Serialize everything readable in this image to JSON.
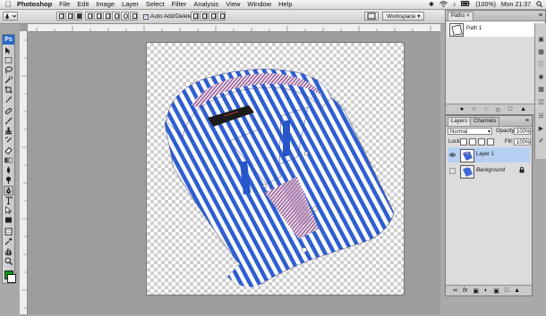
{
  "menubar": {
    "apple_icon": "apple-icon",
    "app_name": "Photoshop",
    "items": [
      "File",
      "Edit",
      "Image",
      "Layer",
      "Select",
      "Filter",
      "Analysis",
      "View",
      "Window",
      "Help"
    ],
    "battery": "(100%)",
    "clock": "Mon 21:37"
  },
  "options_bar": {
    "auto_add_delete_label": "Auto Add/Delete",
    "auto_add_delete_checked": true,
    "workspace_label": "Workspace"
  },
  "toolbox": {
    "badge": "Ps",
    "tools": [
      "move",
      "marquee",
      "lasso",
      "quick-selection",
      "crop",
      "slice",
      "healing-brush",
      "brush",
      "clone-stamp",
      "history-brush",
      "eraser",
      "gradient",
      "blur",
      "dodge",
      "pen",
      "type",
      "path-selection",
      "shape",
      "notes",
      "eyedropper",
      "hand",
      "zoom"
    ],
    "foreground_color": "#0b9a1a",
    "background_color": "#ffffff"
  },
  "paths_panel": {
    "tab": "Paths",
    "items": [
      {
        "name": "Path 1"
      }
    ]
  },
  "layers_panel": {
    "tabs": [
      "Layers",
      "Channels"
    ],
    "blend_mode": "Normal",
    "opacity_label": "Opacity:",
    "opacity": "100%",
    "lock_label": "Lock:",
    "fill_label": "Fill:",
    "fill": "100%",
    "layers": [
      {
        "name": "Layer 1",
        "selected": true,
        "visible": true
      },
      {
        "name": "Background",
        "selected": false,
        "visible": false,
        "locked": true
      }
    ]
  },
  "colors": {
    "selection_blue": "#b7cff3",
    "shirt_blue": "#2f5fd0",
    "app_gray": "#a9a9a9"
  }
}
